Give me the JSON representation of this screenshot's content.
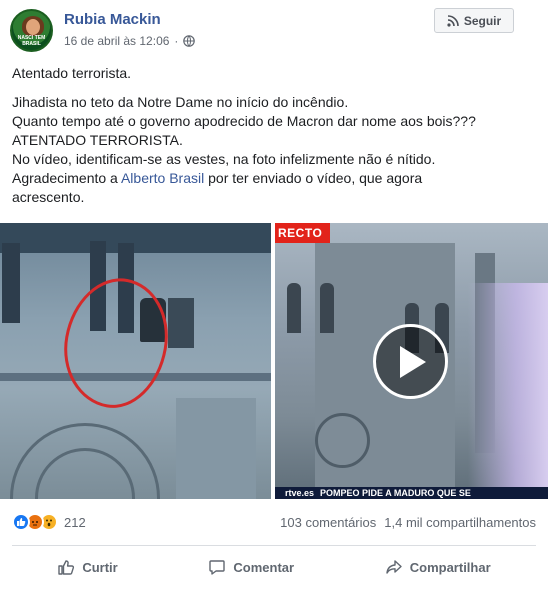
{
  "post": {
    "author": "Rubia Mackin",
    "avatar_text": "NASCI TEM BRASIL",
    "timestamp": "16 de abril às 12:06",
    "privacy_icon": "globe-icon",
    "follow_label": "Seguir",
    "follow_icon": "rss-icon",
    "text_line1": "Atentado terrorista.",
    "text_p2_l1": "Jihadista no teto da Notre Dame no início do incêndio.",
    "text_p2_l2": "Quanto tempo até o governo apodrecido de Macron dar nome aos bois???",
    "text_p2_l3": "ATENTADO TERRORISTA.",
    "text_p2_l4": "No vídeo, identificam-se as vestes, na foto infelizmente não é nítido.",
    "text_p2_l5_pre": "Agradecimento a ",
    "text_p2_l5_link": "Alberto Brasil",
    "text_p2_l5_post": " por ter enviado o vídeo, que agora",
    "text_p2_l6": "acrescento."
  },
  "media": {
    "right_overlay_label": "RECTO",
    "ticker_logo": "rtve.es",
    "ticker_text": "POMPEO PIDE A MADURO QUE SE",
    "play_icon": "play-icon"
  },
  "footer": {
    "reaction_icons": [
      "like-reaction-icon",
      "angry-reaction-icon",
      "wow-reaction-icon"
    ],
    "reaction_count": "212",
    "comments": "103 comentários",
    "shares": "1,4 mil compartilhamentos",
    "actions": {
      "like": "Curtir",
      "comment": "Comentar",
      "share": "Compartilhar"
    }
  },
  "colors": {
    "link": "#385898",
    "meta": "#616770",
    "like_blue": "#1877f2",
    "live_red": "#e2231a"
  }
}
